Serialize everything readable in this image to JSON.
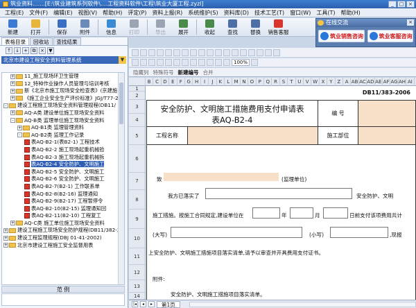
{
  "window": {
    "title": "筑业资料.......[E:\\筑业建筑系列软件\\....工程资料软件\\工程\\筑业大厦工程.zyzl]",
    "buttons": [
      "_",
      "□",
      "×"
    ]
  },
  "menu": [
    "工程(E)",
    "文件(F)",
    "编辑(E)",
    "视图(V)",
    "帮助(H)",
    "评定(P)",
    "资料上报(R)",
    "系统维护(S)",
    "资料库(D)",
    "技术工艺(T)",
    "窗口(W)",
    "工具(T)",
    "帮助(H)"
  ],
  "toolbar": [
    {
      "label": "新建",
      "icon": "new-file-icon",
      "color": "#3b7bd4"
    },
    {
      "label": "打开",
      "icon": "open-folder-icon",
      "color": "#e9b43a"
    },
    {
      "label": "保存",
      "icon": "save-icon",
      "color": "#3a6fc4"
    },
    {
      "label": "附件",
      "icon": "attachment-icon",
      "color": "#6a8ab8"
    },
    {
      "label": "信息",
      "icon": "info-icon",
      "color": "#3b8ad4"
    },
    {
      "label": "打印",
      "icon": "printer-icon",
      "color": "#9aa4b2",
      "disabled": true
    },
    {
      "label": "导出",
      "icon": "export-icon",
      "color": "#9aa4b2",
      "disabled": true
    },
    {
      "label": "展开",
      "icon": "expand-icon",
      "color": "#4a8a4a"
    },
    {
      "label": "收起",
      "icon": "collapse-icon",
      "color": "#4a8a4a"
    },
    {
      "label": "查找",
      "icon": "search-icon",
      "color": "#4d6fa8"
    },
    {
      "label": "替换",
      "icon": "replace-icon",
      "color": "#4d6fa8"
    },
    {
      "label": "销售客服",
      "icon": "support-icon",
      "color": "#d9362b"
    }
  ],
  "chat": {
    "title": "在线交流",
    "sales": "筑业销售咨询",
    "support": "筑业客服咨询"
  },
  "left": {
    "tabs": [
      "表格目录",
      "回收站",
      "查找结果"
    ],
    "combo": "北京市建设工程安全资料管理系统",
    "tree": [
      {
        "indent": 1,
        "type": "folder",
        "expander": "+",
        "label": "11_施工现场环卫生管理"
      },
      {
        "indent": 1,
        "type": "folder",
        "expander": "+",
        "label": "12_特种作业操作人员管理与培训考核"
      },
      {
        "indent": 1,
        "type": "folder",
        "expander": "+",
        "label": "新《北京市施工现场安全检查表》(京建施"
      },
      {
        "indent": 1,
        "type": "folder",
        "expander": "+",
        "label": "《施工企业安全生产评价标准》JGJ/T77-20"
      },
      {
        "indent": 0,
        "type": "folder",
        "expander": "-",
        "label": "建设工程施工现场安全资料管理规程(DB11/"
      },
      {
        "indent": 1,
        "type": "folder",
        "expander": "+",
        "label": "AQ-A类  建设单位施工现场安全资料"
      },
      {
        "indent": 1,
        "type": "folder",
        "expander": "-",
        "label": "AQ-B类  监理单位施工现场安全资料"
      },
      {
        "indent": 2,
        "type": "folder",
        "expander": "+",
        "label": "AQ-B1类  监理管理资料"
      },
      {
        "indent": 2,
        "type": "folder",
        "expander": "-",
        "label": "AQ-B2类  监理工作记录"
      },
      {
        "indent": 3,
        "type": "file",
        "label": "表AQ-B2-1(表B2-1) 工程技术"
      },
      {
        "indent": 3,
        "type": "file",
        "label": "表AQ-B2-2  施工现场起重机械验"
      },
      {
        "indent": 3,
        "type": "file",
        "label": "表AQ-B2-3  施工现场起重机械拆"
      },
      {
        "indent": 3,
        "type": "file",
        "label": "表AQ-B2-4  安全防护、文明施工",
        "selected": true
      },
      {
        "indent": 3,
        "type": "file",
        "label": "表AQ-B2-5  安全防护、文明施工"
      },
      {
        "indent": 3,
        "type": "file",
        "label": "表AQ-B2-6  安全防护、文明施工"
      },
      {
        "indent": 3,
        "type": "file",
        "label": "表AQ-B2-7(B2-1)  工作联系单"
      },
      {
        "indent": 3,
        "type": "file",
        "label": "表AQ-B2-8(B2-16)  监理通知"
      },
      {
        "indent": 3,
        "type": "file",
        "label": "表AQ-B2-9(B2-17)  工程暂停令"
      },
      {
        "indent": 3,
        "type": "file",
        "label": "表AQ-B2-10(B2-15)  监理通知回"
      },
      {
        "indent": 3,
        "type": "file",
        "label": "表AQ-B2-11(B2-10)  工程复工"
      },
      {
        "indent": 1,
        "type": "folder",
        "expander": "+",
        "label": "AQ-C类  施工单位施工现场安全资料"
      },
      {
        "indent": 0,
        "type": "folder",
        "expander": "+",
        "label": "建设工程施工现场安全防护规程(DB11/382-2006)"
      },
      {
        "indent": 0,
        "type": "folder",
        "expander": "+",
        "label": "建设工程监理规程(DBJ 01-41-2002)"
      },
      {
        "indent": 0,
        "type": "folder",
        "expander": "+",
        "label": "北京市建设工程施工安全监督用表"
      }
    ],
    "bottom_label": "范    例"
  },
  "fmt": {
    "zoom": "100%",
    "row3": [
      "隐藏列",
      "特殊符号",
      "新建编号",
      "合并"
    ]
  },
  "sheet": {
    "columns": [
      "B",
      "C",
      "D",
      "E",
      "F",
      "G",
      "H",
      "I",
      "J",
      "K",
      "L",
      "M",
      "N",
      "O",
      "P",
      "Q",
      "R",
      "S",
      "T",
      "U",
      "V",
      "W",
      "X",
      "Y",
      "Z",
      "A",
      "AB",
      "AC",
      "AD",
      "AE",
      "AF",
      "AG",
      "AH",
      "AI"
    ],
    "rows": [
      "1",
      "2",
      "3",
      "4",
      "5",
      "6",
      "7",
      "8",
      "9",
      "10",
      "11",
      "12",
      "13",
      "14",
      "15",
      "16"
    ],
    "std_code": "DB11/383-2006",
    "title": "安全防护、文明施工措施费用支付申请表",
    "form_code": "表AQ-B2-4",
    "bh_label": "编    号",
    "project_label": "工程名称",
    "location_label": "施工部位",
    "to_label": "致",
    "to_suffix": "(监理单位)",
    "line1_pre": "我方已落实了",
    "line1_suf": "安全防护、文明",
    "line2_pre": "施工措施。按施工合同规定,建设单位在",
    "line2_year": "年",
    "line2_month": "月",
    "line2_suf": "日前支付该项费用共计",
    "line3_pre": "(大写)",
    "line3_mid": "(小写)",
    "line3_suf": ",现报",
    "line4": "上安全防护、文明施工措施项目落实清单,请予以审查并开具费用支付证书。",
    "attach_label": "附件:",
    "attach_item": "安全防护、文明施工措施项目落实清单。"
  },
  "tabs": {
    "sheet1": "第1页"
  }
}
